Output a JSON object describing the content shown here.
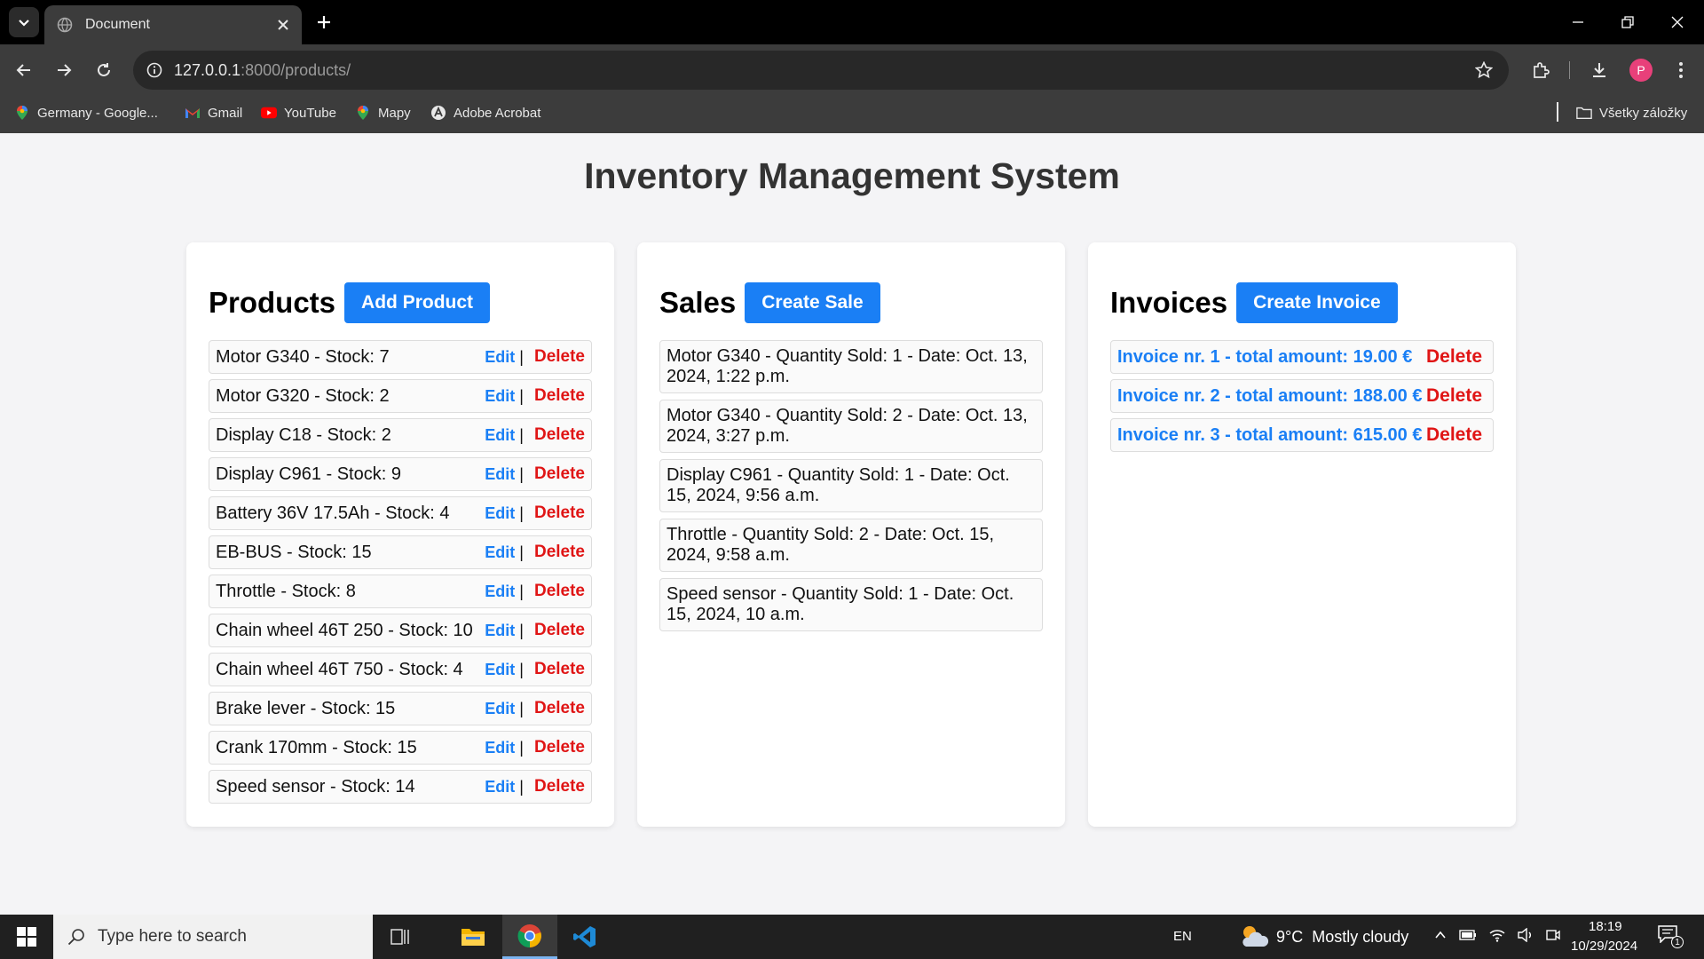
{
  "browser": {
    "tab_title": "Document",
    "url_host": "127.0.0.1",
    "url_rest": ":8000/products/",
    "avatar_letter": "P",
    "bookmarks": [
      {
        "label": "Germany - Google...",
        "icon": "maps-pin-icon"
      },
      {
        "label": "Gmail",
        "icon": "gmail-icon"
      },
      {
        "label": "YouTube",
        "icon": "youtube-icon"
      },
      {
        "label": "Mapy",
        "icon": "maps-pin-icon"
      },
      {
        "label": "Adobe Acrobat",
        "icon": "acrobat-icon"
      }
    ],
    "all_bookmarks": "Všetky záložky"
  },
  "page": {
    "title": "Inventory Management System"
  },
  "products": {
    "heading": "Products",
    "add_label": "Add Product",
    "edit_label": "Edit",
    "separator": "|",
    "delete_label": "Delete",
    "items": [
      "Motor G340 - Stock: 7",
      "Motor G320 - Stock: 2",
      "Display C18 - Stock: 2",
      "Display C961 - Stock: 9",
      "Battery 36V 17.5Ah - Stock: 4",
      "EB-BUS - Stock: 15",
      "Throttle - Stock: 8",
      "Chain wheel 46T 250 - Stock: 10",
      "Chain wheel 46T 750 - Stock: 4",
      "Brake lever - Stock: 15",
      "Crank 170mm - Stock: 15",
      "Speed sensor - Stock: 14"
    ]
  },
  "sales": {
    "heading": "Sales",
    "create_label": "Create Sale",
    "items": [
      "Motor G340 - Quantity Sold: 1 - Date: Oct. 13, 2024, 1:22 p.m.",
      "Motor G340 - Quantity Sold: 2 - Date: Oct. 13, 2024, 3:27 p.m.",
      "Display C961 - Quantity Sold: 1 - Date: Oct. 15, 2024, 9:56 a.m.",
      "Throttle - Quantity Sold: 2 - Date: Oct. 15, 2024, 9:58 a.m.",
      "Speed sensor - Quantity Sold: 1 - Date: Oct. 15, 2024, 10 a.m."
    ]
  },
  "invoices": {
    "heading": "Invoices",
    "create_label": "Create Invoice",
    "delete_label": "Delete",
    "items": [
      "Invoice nr. 1 - total amount: 19.00 €",
      "Invoice nr. 2 - total amount: 188.00 €",
      "Invoice nr. 3 - total amount: 615.00 €"
    ]
  },
  "taskbar": {
    "search_placeholder": "Type here to search",
    "language": "EN",
    "weather": "9°C  Mostly cloudy",
    "time": "18:19",
    "date": "10/29/2024",
    "notification_count": "1"
  },
  "colors": {
    "primary": "#1a7ff5",
    "danger": "#e01515"
  }
}
